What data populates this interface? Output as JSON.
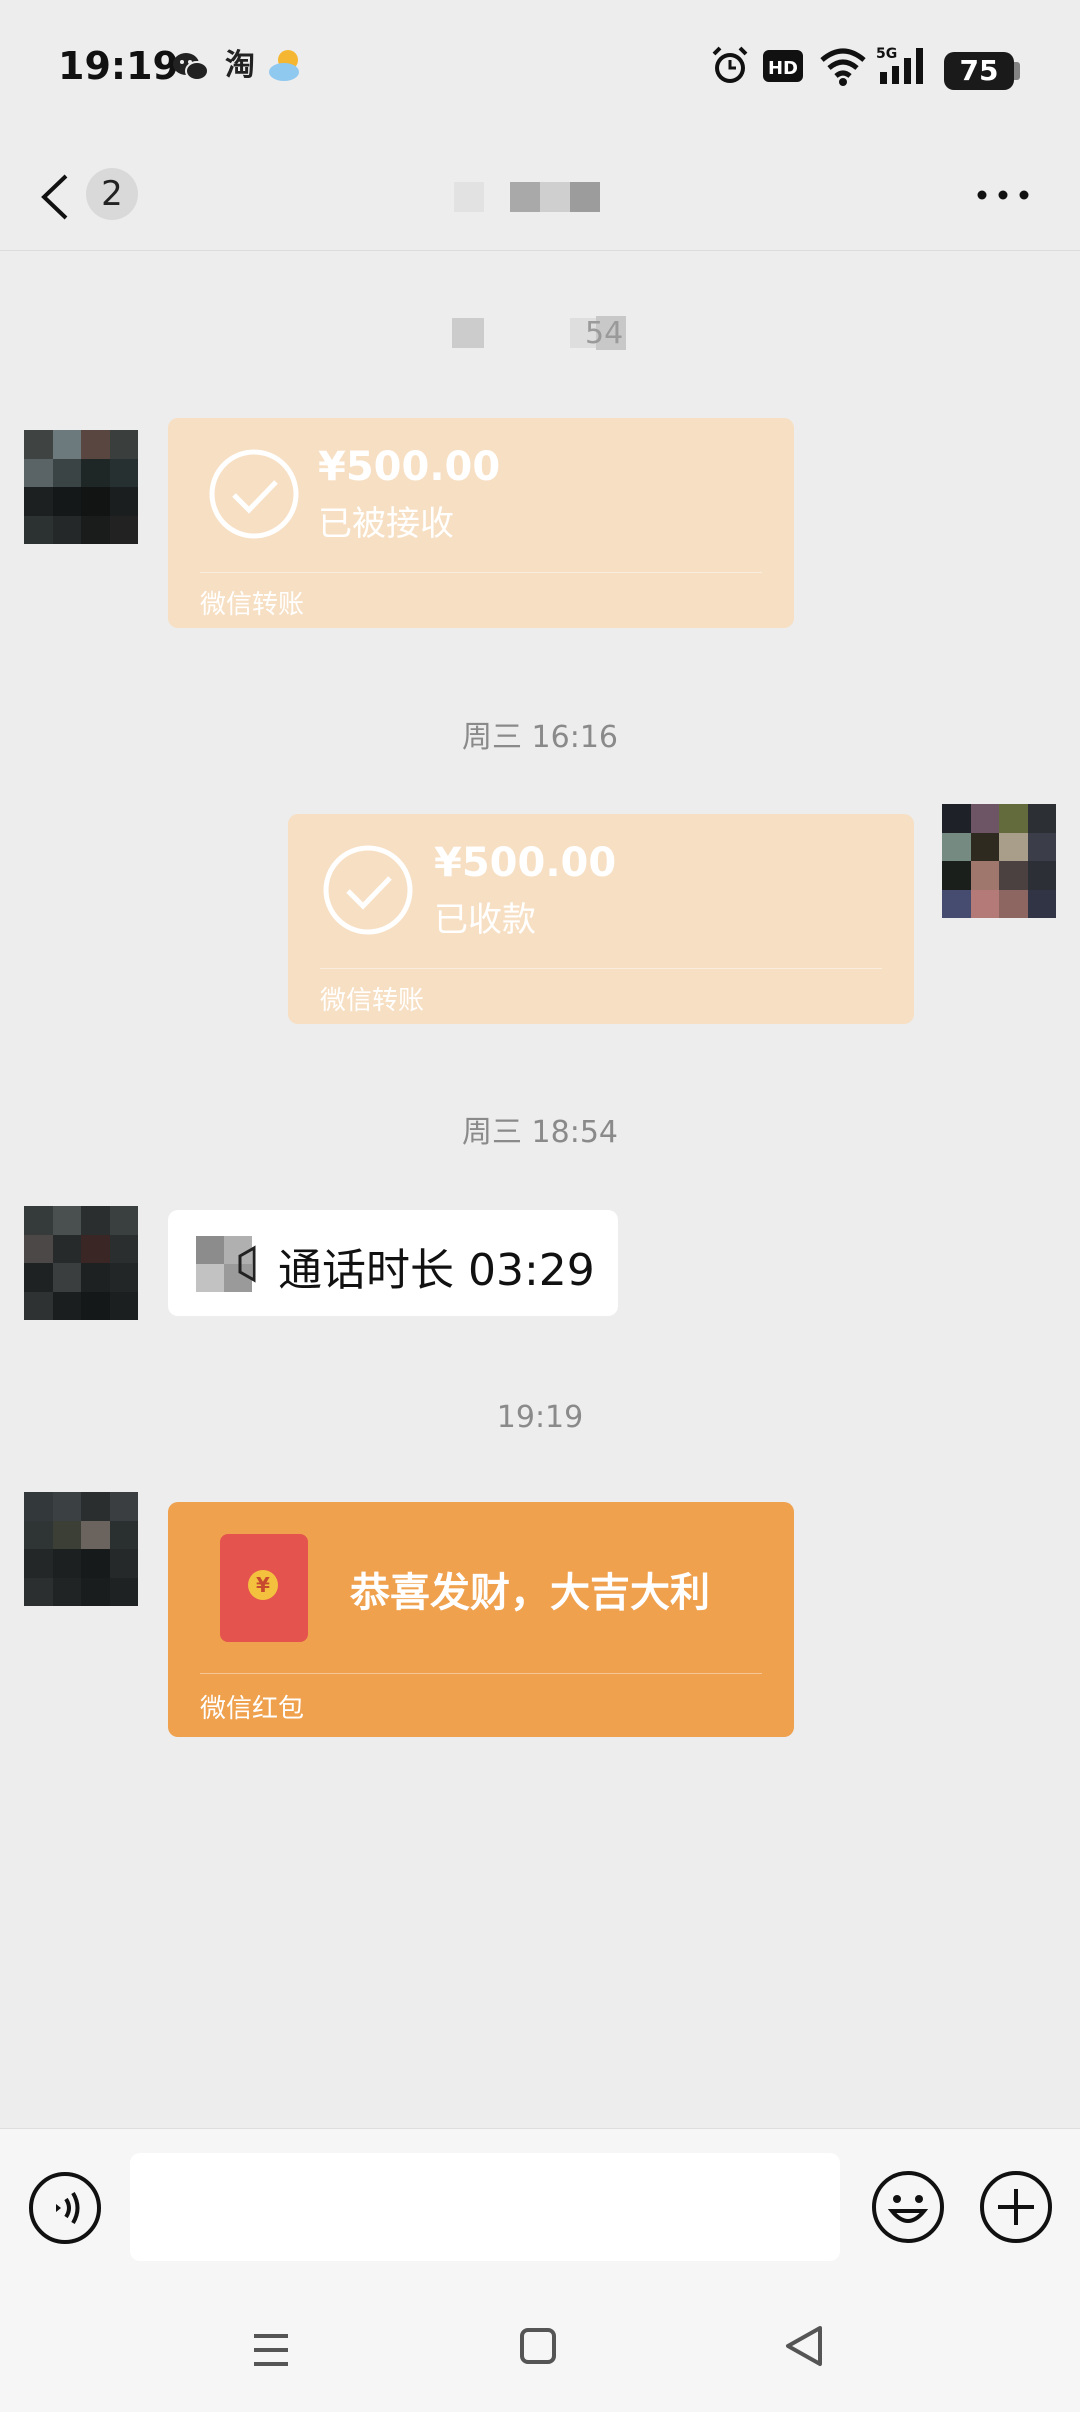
{
  "status_bar": {
    "time": "19:19",
    "taobao_glyph": "淘",
    "battery": "75",
    "icons": [
      "wechat-icon",
      "taobao-icon",
      "weather-icon",
      "alarm-icon",
      "hd-icon",
      "wifi-icon",
      "signal-5g-icon",
      "battery-icon"
    ]
  },
  "header": {
    "unread_count": "2",
    "title_redacted": true,
    "more_icon": "more-dots-icon"
  },
  "messages": [
    {
      "type": "timestamp",
      "text": "54"
    },
    {
      "type": "transfer",
      "direction": "incoming",
      "amount": "¥500.00",
      "status": "已被接收",
      "source": "微信转账"
    },
    {
      "type": "timestamp",
      "text": "周三 16:16"
    },
    {
      "type": "transfer",
      "direction": "outgoing",
      "amount": "¥500.00",
      "status": "已收款",
      "source": "微信转账"
    },
    {
      "type": "timestamp",
      "text": "周三 18:54"
    },
    {
      "type": "video_call",
      "direction": "incoming",
      "text": "通话时长 03:29"
    },
    {
      "type": "timestamp",
      "text": "19:19"
    },
    {
      "type": "red_packet",
      "direction": "incoming",
      "greeting": "恭喜发财，大吉大利",
      "coin": "¥",
      "source": "微信红包"
    }
  ],
  "input_bar": {
    "placeholder": "",
    "icons": [
      "voice-icon",
      "emoji-icon",
      "add-icon"
    ]
  },
  "colors": {
    "background": "#EDEDED",
    "transfer_card": "#F7DFC3",
    "red_packet": "#EFA14E",
    "red_envelope": "#E4534E"
  }
}
